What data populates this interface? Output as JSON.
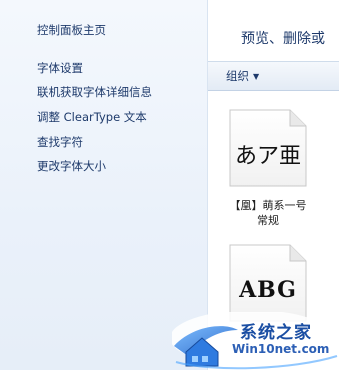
{
  "nav": {
    "items": [
      "控制面板主页",
      "字体设置",
      "联机获取字体详细信息",
      "调整 ClearType 文本",
      "查找字符",
      "更改字体大小"
    ]
  },
  "main": {
    "heading": "预览、删除或",
    "toolbar": {
      "organize_label": "组织",
      "organize_icon": "chevron-down-icon"
    },
    "fonts": [
      {
        "sample": "あア亜",
        "caption_line1": "【凰】萌系一号",
        "caption_line2": "常规"
      },
      {
        "sample": "ABG"
      }
    ]
  },
  "watermark": {
    "title": "系统之家",
    "url": "Win10net.com"
  },
  "colors": {
    "link": "#1e3a6b",
    "sidebar_bg": "#eaf1fa",
    "watermark_blue": "#1a4ea3"
  }
}
